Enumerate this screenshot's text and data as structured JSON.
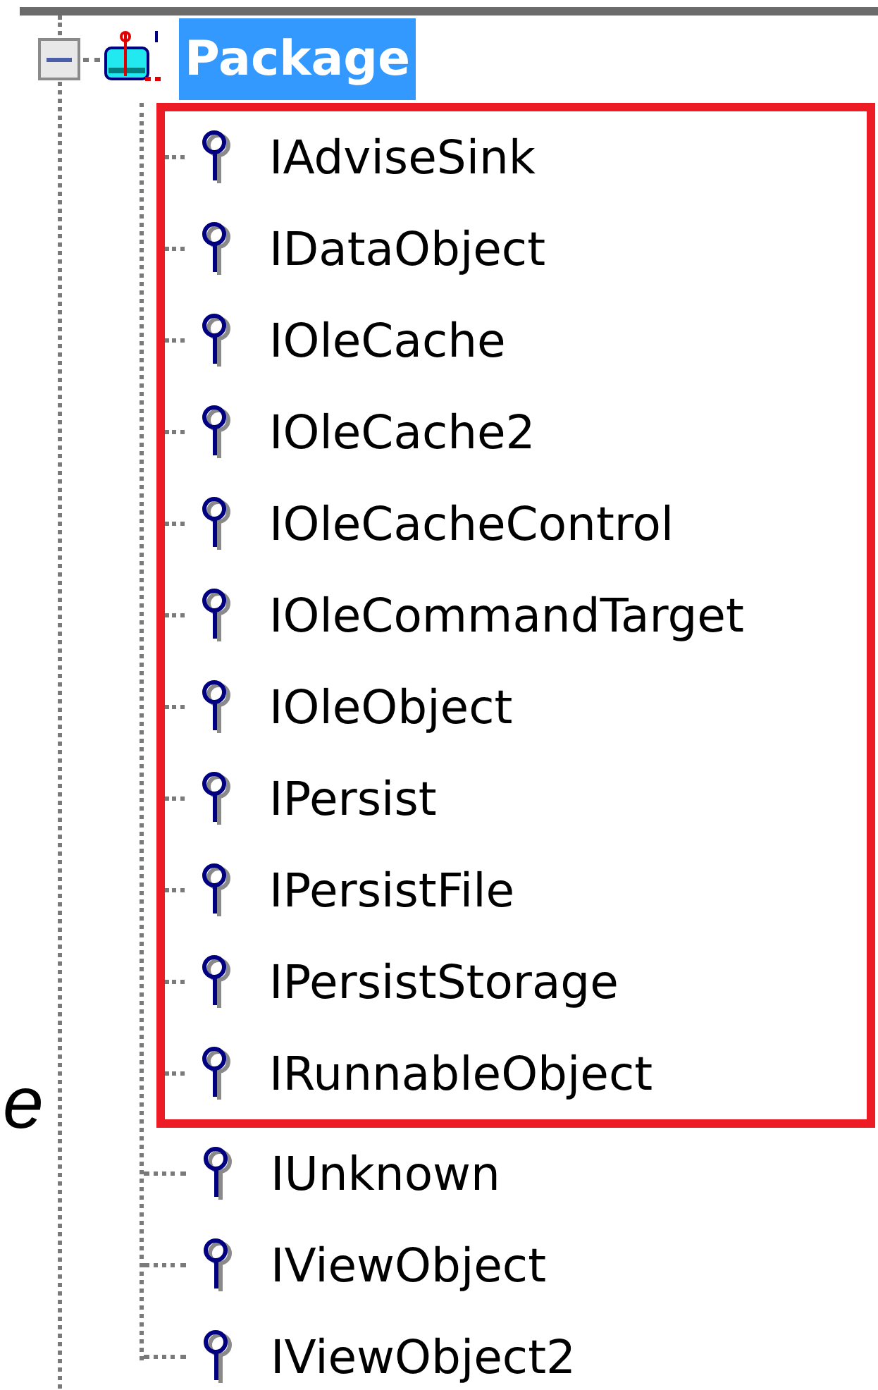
{
  "side_note": "e",
  "tree": {
    "root": {
      "label": "Package",
      "selected": true,
      "expanded": true,
      "children": [
        {
          "label": "IAdviseSink",
          "highlighted": true
        },
        {
          "label": "IDataObject",
          "highlighted": true
        },
        {
          "label": "IOleCache",
          "highlighted": true
        },
        {
          "label": "IOleCache2",
          "highlighted": true
        },
        {
          "label": "IOleCacheControl",
          "highlighted": true
        },
        {
          "label": "IOleCommandTarget",
          "highlighted": true
        },
        {
          "label": "IOleObject",
          "highlighted": true
        },
        {
          "label": "IPersist",
          "highlighted": true
        },
        {
          "label": "IPersistFile",
          "highlighted": true
        },
        {
          "label": "IPersistStorage",
          "highlighted": true
        },
        {
          "label": "IRunnableObject",
          "highlighted": true
        },
        {
          "label": "IUnknown",
          "highlighted": false
        },
        {
          "label": "IViewObject",
          "highlighted": false
        },
        {
          "label": "IViewObject2",
          "highlighted": false
        }
      ]
    }
  }
}
